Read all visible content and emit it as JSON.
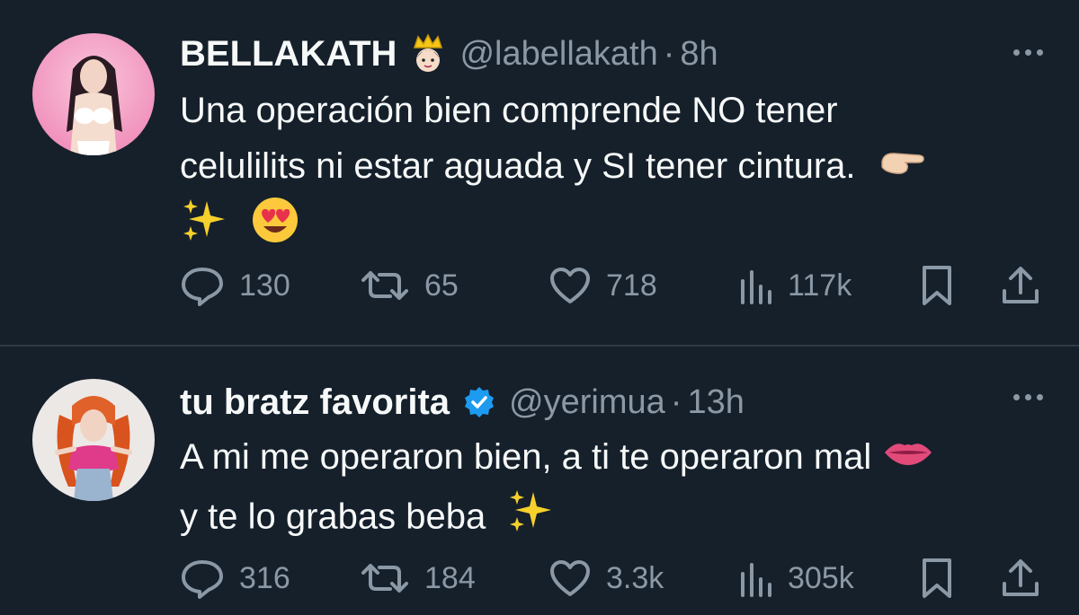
{
  "tweets": [
    {
      "author_name": "BELLAKATH",
      "author_handle": "@labellakath",
      "separator": "·",
      "time": "8h",
      "badge_icon": "crown-emoji-icon",
      "text_lines": [
        "Una operación bien comprende NO tener",
        "celulilits ni estar aguada y SI tener cintura."
      ],
      "stats": {
        "replies": "130",
        "reposts": "65",
        "likes": "718",
        "views": "117k"
      }
    },
    {
      "author_name": "tu bratz favorita",
      "author_handle": "@yerimua",
      "separator": "·",
      "time": "13h",
      "badge_icon": "verified-badge-icon",
      "text_lines": [
        "A mi me operaron bien, a ti te operaron mal",
        "y te lo grabas beba"
      ],
      "stats": {
        "replies": "316",
        "reposts": "184",
        "likes": "3.3k",
        "views": "305k"
      }
    }
  ],
  "colors": {
    "background": "#15202b",
    "text": "#f7f9f9",
    "muted": "#8b98a5",
    "verified": "#1d9bf0",
    "divider": "#2f3b47"
  }
}
